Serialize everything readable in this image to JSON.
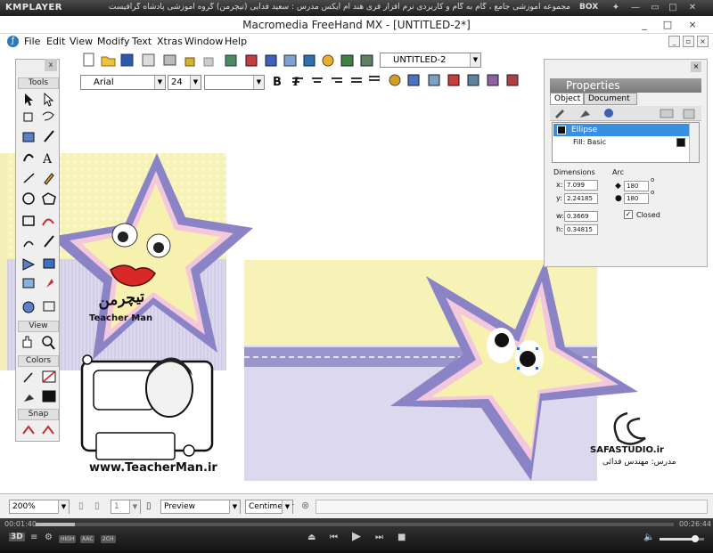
{
  "kmplayer": {
    "logo": "KMPLAYER",
    "title": "مجموعه آموزشی جامع ، گام به گام و کاربردی نرم افزار فری هند ام ایکس   مدرس : سعید فدایی (تیچرمن) گروه آموزشی پادشاه گرافیست ها",
    "box_label": "BOX",
    "time_elapsed": "00:01:40",
    "time_total": "00:26:44",
    "progress_fraction": 0.062,
    "volume_fraction": 0.8,
    "mode_pills": [
      "HIGH",
      "AAC",
      "2CH"
    ],
    "badge_3d": "3D"
  },
  "window": {
    "title": "Macromedia FreeHand MX - [UNTITLED-2*]",
    "minimize": "_",
    "maximize": "□",
    "close": "×"
  },
  "menu": [
    "File",
    "Edit",
    "View",
    "Modify",
    "Text",
    "Xtras",
    "Window",
    "Help"
  ],
  "toolbar": {
    "page_select": "UNTITLED-2",
    "font_select": "Arial",
    "size_select": "24",
    "style_select": "",
    "bold": "B",
    "italic": "I"
  },
  "tools_panel": {
    "close": "x",
    "sections": [
      "Tools",
      "View",
      "Colors",
      "Snap"
    ]
  },
  "properties": {
    "title": "Properties",
    "tabs": [
      "Object",
      "Document"
    ],
    "list": [
      {
        "label": "Ellipse",
        "selected": true
      },
      {
        "label": "Fill: Basic",
        "selected": false
      }
    ],
    "dimensions_label": "Dimensions",
    "x_label": "x:",
    "x_value": "7.099",
    "y_label": "y:",
    "y_value": "2.24185",
    "w_label": "w:",
    "w_value": "0.3669",
    "h_label": "h:",
    "h_value": "0.34815",
    "arc_label": "Arc",
    "arc_start": "180",
    "arc_end": "180",
    "closed_label": "Closed",
    "closed_checked": true
  },
  "artwork": {
    "teacher_site": "www.TeacherMan.ir",
    "teacher_name": "Teacher Man",
    "teacher_brand": "تیچرمن",
    "studio": "SAFASTUDIO.ir",
    "studio_credit": "مدرس: مهندس فدائی"
  },
  "status_bar": {
    "zoom": "200%",
    "page": "1",
    "view_mode": "Preview",
    "units": "Centimeter"
  }
}
